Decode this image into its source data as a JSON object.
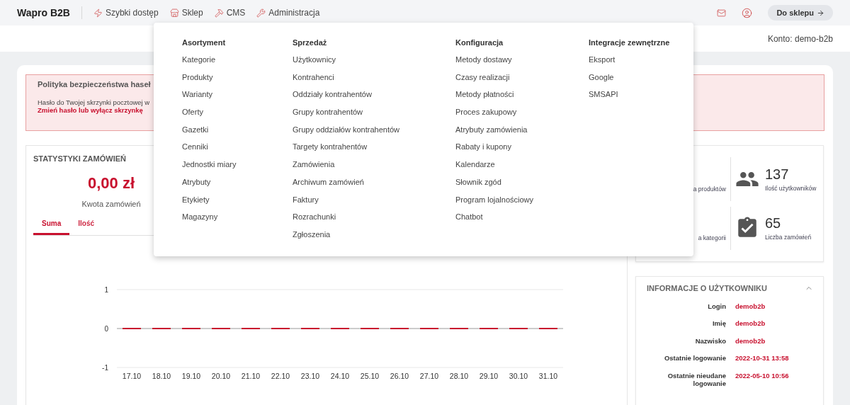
{
  "nav": {
    "brand": "Wapro B2B",
    "items": [
      {
        "label": "Szybki dostęp",
        "kind": "quick"
      },
      {
        "label": "Sklep",
        "kind": "shop"
      },
      {
        "label": "CMS",
        "kind": "cms"
      },
      {
        "label": "Administracja",
        "kind": "admin"
      }
    ],
    "shop_button": "Do sklepu"
  },
  "account": "Konto: demo-b2b",
  "alert": {
    "title": "Polityka bezpieczeństwa haseł",
    "message": "Hasło do Twojej skrzynki pocztowej w",
    "link": "Zmień hasło lub wyłącz skrzynkę"
  },
  "order_stats": {
    "title": "STATYSTYKI ZAMÓWIEŃ",
    "amount": "0,00 zł",
    "amount_label": "Kwota zamówień",
    "tabs": [
      {
        "label": "Suma",
        "selected": true
      },
      {
        "label": "Ilość",
        "selected": false
      }
    ],
    "chart_data": {
      "type": "bar",
      "categories": [
        "17.10",
        "18.10",
        "19.10",
        "20.10",
        "21.10",
        "22.10",
        "23.10",
        "24.10",
        "25.10",
        "26.10",
        "27.10",
        "28.10",
        "29.10",
        "30.10",
        "31.10"
      ],
      "values": [
        0,
        0,
        0,
        0,
        0,
        0,
        0,
        0,
        0,
        0,
        0,
        0,
        0,
        0,
        0
      ],
      "ylim": [
        -1,
        1
      ],
      "yticks": [
        -1,
        0,
        1
      ]
    }
  },
  "stats": [
    {
      "label": "a produktów"
    },
    {
      "value": "137",
      "label": "Ilość użytkowników",
      "kind": "users"
    },
    {
      "label": "a kategorii"
    },
    {
      "value": "65",
      "label": "Liczba zamówień",
      "kind": "orders"
    }
  ],
  "user_info": {
    "title": "INFORMACJE O UŻYTKOWNIKU",
    "expanded": true,
    "rows": [
      {
        "label": "Login",
        "value": "demob2b"
      },
      {
        "label": "Imię",
        "value": "demob2b"
      },
      {
        "label": "Nazwisko",
        "value": "demob2b"
      },
      {
        "label": "Ostatnie logowanie",
        "value": "2022-10-31 13:58"
      },
      {
        "label": "Ostatnie nieudane logowanie",
        "value": "2022-05-10 10:56"
      }
    ]
  },
  "mega_menu": {
    "columns": [
      {
        "title": "Asortyment",
        "items": [
          "Kategorie",
          "Produkty",
          "Warianty",
          "Oferty",
          "Gazetki",
          "Cenniki",
          "Jednostki miary",
          "Atrybuty",
          "Etykiety",
          "Magazyny"
        ]
      },
      {
        "title": "Sprzedaż",
        "items": [
          "Użytkownicy",
          "Kontrahenci",
          "Oddziały kontrahentów",
          "Grupy kontrahentów",
          "Grupy oddziałów kontrahentów",
          "Targety kontrahentów",
          "Zamówienia",
          "Archiwum zamówień",
          "Faktury",
          "Rozrachunki",
          "Zgłoszenia"
        ]
      },
      {
        "title": "Konfiguracja",
        "items": [
          "Metody dostawy",
          "Czasy realizacji",
          "Metody płatności",
          "Proces zakupowy",
          "Atrybuty zamówienia",
          "Rabaty i kupony",
          "Kalendarze",
          "Słownik zgód",
          "Program lojalnościowy",
          "Chatbot"
        ]
      },
      {
        "title": "Integracje zewnętrzne",
        "items": [
          "Eksport",
          "Google",
          "SMSAPI"
        ]
      }
    ]
  }
}
